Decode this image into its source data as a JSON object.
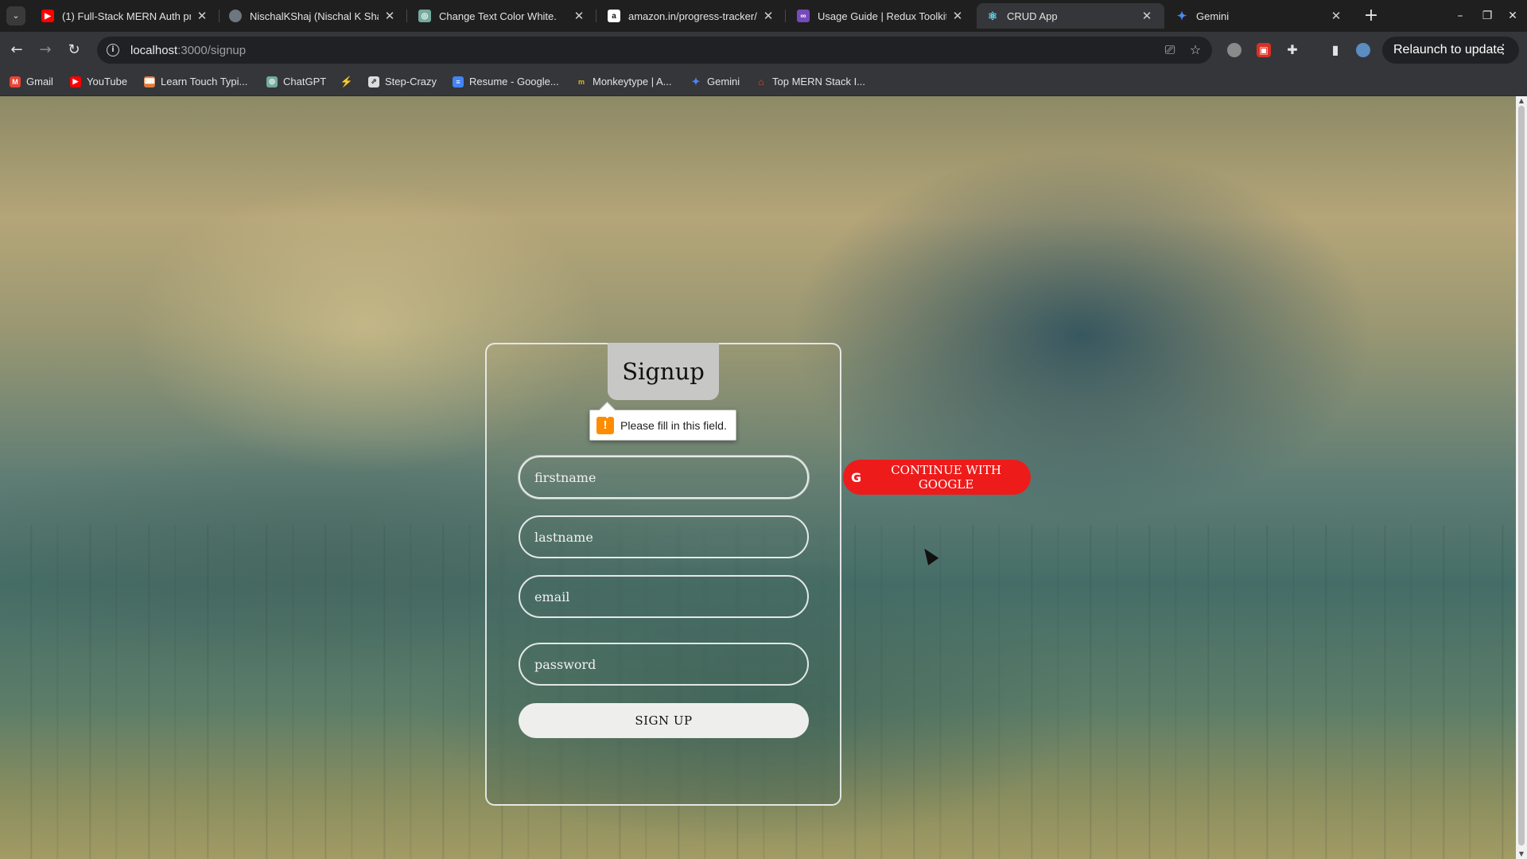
{
  "browser": {
    "tab_menu_icon": "chevron-down-icon",
    "tabs": [
      {
        "title": "(1) Full-Stack MERN Auth pro",
        "favicon": "youtube-icon",
        "color": "#ff0000"
      },
      {
        "title": "NischalKShaj (Nischal K Shaj)",
        "favicon": "github-icon",
        "color": "#6e7681"
      },
      {
        "title": "Change Text Color White.",
        "favicon": "chatgpt-icon",
        "color": "#74aa9c"
      },
      {
        "title": "amazon.in/progress-tracker/",
        "favicon": "amazon-icon",
        "color": "#ffffff"
      },
      {
        "title": "Usage Guide | Redux Toolkit",
        "favicon": "redux-icon",
        "color": "#764abc"
      },
      {
        "title": "CRUD App",
        "favicon": "react-icon",
        "color": "#61dafb",
        "active": true
      },
      {
        "title": "Gemini",
        "favicon": "gemini-icon",
        "color": "#4a86f7"
      }
    ],
    "new_tab": "+",
    "window_controls": {
      "minimize": "–",
      "restore": "❐",
      "close": "✕"
    },
    "url_host": "localhost",
    "url_path": ":3000/signup",
    "relaunch_label": "Relaunch to update",
    "bookmarks": [
      {
        "label": "Gmail",
        "icon": "gmail-icon",
        "color": "#ea4335"
      },
      {
        "label": "YouTube",
        "icon": "youtube-icon",
        "color": "#ff0000"
      },
      {
        "label": "Learn Touch Typi...",
        "icon": "typing-icon",
        "color": "#e07b39"
      },
      {
        "label": "ChatGPT",
        "icon": "chatgpt-icon",
        "color": "#74aa9c"
      },
      {
        "label": "",
        "icon": "bolt-icon",
        "color": "#e5a00d"
      },
      {
        "label": "Step-Crazy",
        "icon": "step-icon",
        "color": "#dddddd"
      },
      {
        "label": "Resume - Google...",
        "icon": "docs-icon",
        "color": "#4285f4"
      },
      {
        "label": "Monkeytype | A...",
        "icon": "monkeytype-icon",
        "color": "#e2b714"
      },
      {
        "label": "Gemini",
        "icon": "gemini-icon",
        "color": "#4a86f7"
      },
      {
        "label": "Top MERN Stack I...",
        "icon": "mern-icon",
        "color": "#e34c26"
      }
    ]
  },
  "page": {
    "title": "Signup",
    "fields": {
      "firstname": {
        "placeholder": "firstname",
        "value": ""
      },
      "lastname": {
        "placeholder": "lastname",
        "value": ""
      },
      "email": {
        "placeholder": "email",
        "value": ""
      },
      "password": {
        "placeholder": "password",
        "value": ""
      }
    },
    "submit_label": "SIGN UP",
    "google_label": "CONTINUE WITH GOOGLE",
    "google_color": "#ee1b1b",
    "validation_message": "Please fill in this field."
  }
}
